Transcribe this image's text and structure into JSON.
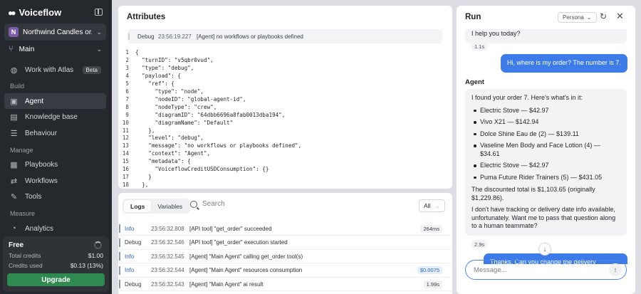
{
  "sidebar": {
    "logo": "Voiceflow",
    "project": {
      "initial": "N",
      "name": "Northwind Candles or..."
    },
    "branch": "Main",
    "atlas": {
      "label": "Work with Atlas",
      "badge": "Beta"
    },
    "sections": {
      "build": "Build",
      "manage": "Manage",
      "measure": "Measure"
    },
    "build_items": [
      {
        "label": "Agent",
        "icon": "agent-icon"
      },
      {
        "label": "Knowledge base",
        "icon": "book-icon"
      },
      {
        "label": "Behaviour",
        "icon": "sliders-icon"
      }
    ],
    "manage_items": [
      {
        "label": "Playbooks",
        "icon": "playbook-icon"
      },
      {
        "label": "Workflows",
        "icon": "workflow-icon"
      },
      {
        "label": "Tools",
        "icon": "tool-icon"
      }
    ],
    "measure_items": [
      {
        "label": "Analytics",
        "icon": "chart-icon"
      }
    ],
    "plan": {
      "name": "Free",
      "total_label": "Total credits",
      "total_value": "$1.00",
      "used_label": "Credits used",
      "used_value": "$0.13 (13%)",
      "upgrade": "Upgrade"
    }
  },
  "attributes": {
    "title": "Attributes",
    "debug": {
      "level": "Debug",
      "time": "23:56:19.227",
      "message": "[Agent] no workflows or playbooks defined"
    },
    "code": [
      "{",
      "  \"turnID\": \"v5qbr0vud\",",
      "  \"type\": \"debug\",",
      "  \"payload\": {",
      "    \"ref\": {",
      "      \"type\": \"node\",",
      "      \"nodeID\": \"global-agent-id\",",
      "      \"nodeType\": \"crew\",",
      "      \"diagramID\": \"64dbb6696a8fab0013dba194\",",
      "      \"diagramName\": \"Default\"",
      "    },",
      "    \"level\": \"debug\",",
      "    \"message\": \"no workflows or playbooks defined\",",
      "    \"context\": \"Agent\",",
      "    \"metadata\": {",
      "      \"VoiceflowCreditUSDConsumption\": {}",
      "    }",
      "  },"
    ]
  },
  "logs": {
    "tabs": [
      "Logs",
      "Variables"
    ],
    "search_placeholder": "Search",
    "filter": "All",
    "rows": [
      {
        "level": "Info",
        "time": "23:56:32.808",
        "message": "[API tool] \"get_order\" succeeded",
        "badge": "264ms"
      },
      {
        "level": "Debug",
        "time": "23:56:32.546",
        "message": "[API tool] \"get_order\" execution started",
        "badge": ""
      },
      {
        "level": "Info",
        "time": "23:56:32.545",
        "message": "[Agent] \"Main Agent\" calling get_order tool(s)",
        "badge": ""
      },
      {
        "level": "Info",
        "time": "23:56:32.544",
        "message": "[Agent] \"Main Agent\" resources consumption",
        "badge": "$0.0075"
      },
      {
        "level": "Debug",
        "time": "23:56:32.543",
        "message": "[Agent] \"Main Agent\" ai result",
        "badge": "1.99s"
      }
    ]
  },
  "run": {
    "title": "Run",
    "persona": "Persona",
    "chat": {
      "first_tail": "I help you today?",
      "first_time": "1.1s",
      "user_msg": "Hi, where is my order? The number is 7.",
      "agent_label": "Agent",
      "intro": "I found your order 7. Here's what's in it:",
      "items": [
        "Electric Stove — $42.97",
        "Vivo X21 — $142.94",
        "Dolce Shine Eau de (2) — $139.11",
        "Vaseline Men Body and Face Lotion (4) — $34.61",
        "Electric Stove — $42.97",
        "Puma Future Rider Trainers (5) — $431.05"
      ],
      "total": "The discounted total is $1,103.65 (originally $1,229.86).",
      "followup": "I don't have tracking or delivery date info available, unfortunately. Want me to pass that question along to a human teammate?",
      "reply_time": "2.9s",
      "user_msg2": "Thanks. Can you change the delivery"
    },
    "input_placeholder": "Message..."
  }
}
